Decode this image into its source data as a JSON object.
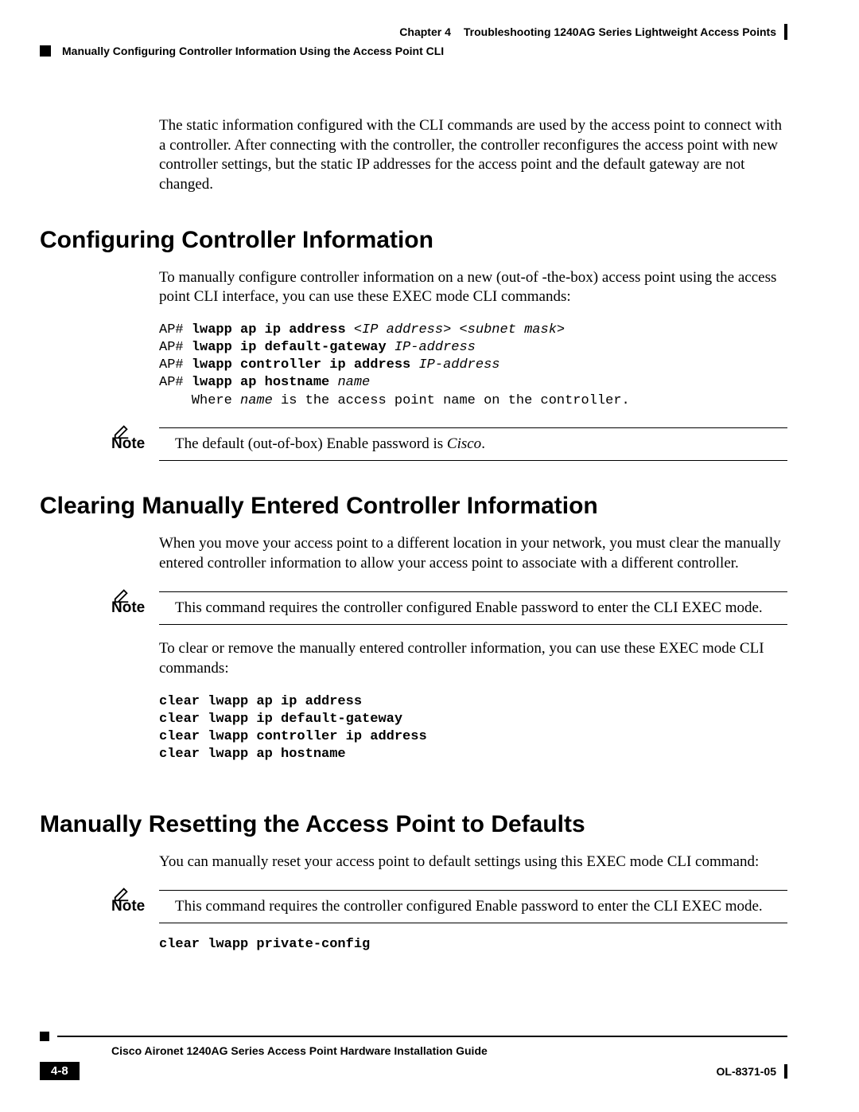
{
  "header": {
    "chapter": "Chapter 4",
    "title": "Troubleshooting 1240AG Series Lightweight Access Points",
    "breadcrumb": "Manually Configuring Controller Information Using the Access Point CLI"
  },
  "intro_para": "The static information configured with the CLI commands are used by the access point to connect with a controller. After connecting with the controller, the controller reconfigures the access point with new controller settings, but the static IP addresses for the access point and the default gateway are not changed.",
  "sections": {
    "s1": {
      "heading": "Configuring Controller Information",
      "para": "To manually configure controller information on a new (out-of -the-box) access point using the access point CLI interface, you can use these EXEC mode CLI commands:",
      "cli_lines": [
        {
          "prompt": "AP# ",
          "bold": "lwapp ap ip address ",
          "italic": "<IP address> <subnet mask>"
        },
        {
          "prompt": "AP# ",
          "bold": "lwapp ip default-gateway ",
          "italic": "IP-address"
        },
        {
          "prompt": "AP# ",
          "bold": "lwapp controller ip address ",
          "italic": "IP-address"
        },
        {
          "prompt": "AP# ",
          "bold": "lwapp ap hostname ",
          "italic": "name"
        },
        {
          "plain": "    Where ",
          "italic": "name",
          "plain2": " is the access point name on the controller."
        }
      ],
      "note_label": "Note",
      "note_text_pre": "The default (out-of-box) Enable password is ",
      "note_text_italic": "Cisco",
      "note_text_post": "."
    },
    "s2": {
      "heading": "Clearing Manually Entered Controller Information",
      "para": "When you move your access point to a different location in your network, you must clear the manually entered controller information to allow your access point to associate with a different controller.",
      "note_label": "Note",
      "note_text": "This command requires the controller configured Enable password to enter the CLI EXEC mode.",
      "para2": "To clear or remove the manually entered controller information, you can use these EXEC mode CLI commands:",
      "cli_lines": [
        {
          "bold": "clear lwapp ap ip address"
        },
        {
          "bold": "clear lwapp ip default-gateway"
        },
        {
          "bold": "clear lwapp controller ip address"
        },
        {
          "bold": "clear lwapp ap hostname"
        }
      ]
    },
    "s3": {
      "heading": "Manually Resetting the Access Point to Defaults",
      "para": "You can manually reset your access point to default settings using this EXEC mode CLI command:",
      "note_label": "Note",
      "note_text": "This command requires the controller configured Enable password to enter the CLI EXEC mode.",
      "cli_lines": [
        {
          "bold": "clear lwapp private-config"
        }
      ]
    }
  },
  "footer": {
    "guide": "Cisco Aironet 1240AG Series Access Point Hardware Installation Guide",
    "page": "4-8",
    "docid": "OL-8371-05"
  }
}
